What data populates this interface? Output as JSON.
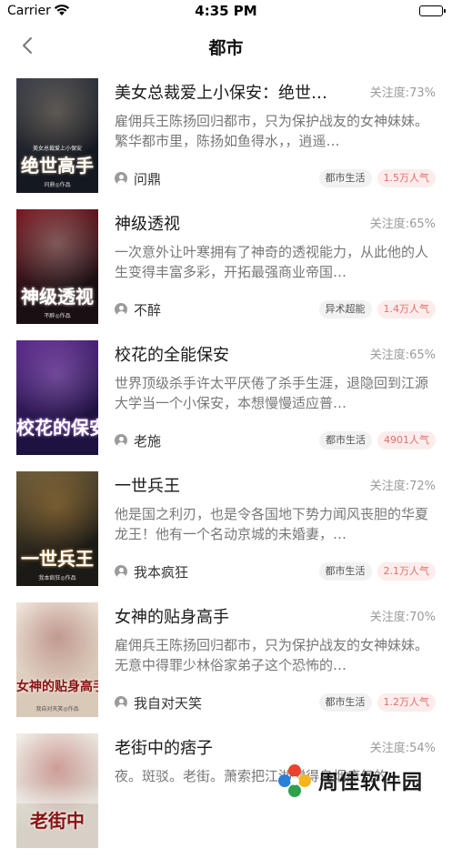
{
  "status_bar": {
    "carrier": "Carrier",
    "time": "4:35 PM",
    "battery_level": 1.0
  },
  "nav": {
    "title": "都市",
    "back_icon": "chevron-left-icon"
  },
  "books": [
    {
      "title": "美女总裁爱上小保安：绝世…",
      "attention": "关注度:73%",
      "description": "雇佣兵王陈扬回归都市，只为保护战友的女神妹妹。繁华都市里，陈扬如鱼得水，，逍遥…",
      "author": "问鼎",
      "category": "都市生活",
      "popularity": "1.5万人气",
      "cover": {
        "title_text": "绝世高手",
        "sub_text": "美女总裁爱上小保安",
        "author_text": "问鼎◎作品",
        "colors": [
          "#3b3f4a",
          "#141820",
          "#c8b08a"
        ]
      }
    },
    {
      "title": "神级透视",
      "attention": "关注度:65%",
      "description": "一次意外让叶寒拥有了神奇的透视能力，从此他的人生变得丰富多彩，开拓最强商业帝国…",
      "author": "不醉",
      "category": "异术超能",
      "popularity": "1.4万人气",
      "cover": {
        "title_text": "神级透视",
        "sub_text": "",
        "author_text": "不醉◎作品",
        "colors": [
          "#7a1a22",
          "#1a1014",
          "#e9e0d6"
        ]
      }
    },
    {
      "title": "校花的全能保安",
      "attention": "关注度:65%",
      "description": "世界顶级杀手许太平厌倦了杀手生涯，退隐回到江源大学当一个小保安，本想慢慢适应普…",
      "author": "老施",
      "category": "都市生活",
      "popularity": "4901人气",
      "cover": {
        "title_text": "校花的保安",
        "sub_text": "",
        "author_text": "",
        "colors": [
          "#5a2a8a",
          "#1e1240",
          "#d8a0ff"
        ]
      }
    },
    {
      "title": "一世兵王",
      "attention": "关注度:72%",
      "description": "他是国之利刃，也是令各国地下势力闻风丧胆的华夏龙王！他有一个名动京城的未婚妻，…",
      "author": "我本疯狂",
      "category": "都市生活",
      "popularity": "2.1万人气",
      "cover": {
        "title_text": "一世兵王",
        "sub_text": "",
        "author_text": "我本疯狂◎作品",
        "colors": [
          "#6a5a3a",
          "#1c1a16",
          "#e0a040"
        ]
      }
    },
    {
      "title": "女神的贴身高手",
      "attention": "关注度:70%",
      "description": "雇佣兵王陈扬回归都市，只为保护战友的女神妹妹。无意中得罪少林俗家弟子这个恐怖的…",
      "author": "我自对天笑",
      "category": "都市生活",
      "popularity": "1.2万人气",
      "cover": {
        "title_text": "女神的贴身高手",
        "sub_text": "",
        "author_text": "我自对天笑◎作品",
        "colors": [
          "#efe6dc",
          "#d9c9b8",
          "#7a1b1b"
        ]
      }
    },
    {
      "title": "老街中的痞子",
      "attention": "关注度:54%",
      "description": "夜。斑驳。老街。萧索把江湖搅得乌烟瘴气的…",
      "author": "",
      "category": "",
      "popularity": "",
      "cover": {
        "title_text": "老街中",
        "sub_text": "",
        "author_text": "",
        "colors": [
          "#f2efe9",
          "#d6d0c6",
          "#a01818"
        ]
      }
    }
  ],
  "watermark": {
    "text": "周佳软件园",
    "icon": "pinwheel-logo-icon"
  }
}
